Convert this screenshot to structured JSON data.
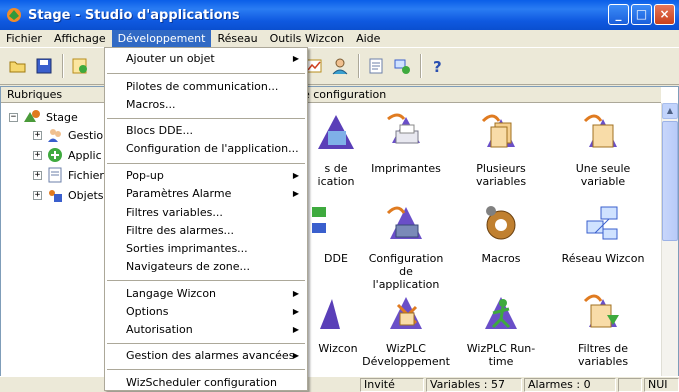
{
  "window": {
    "title": "Stage - Studio d'applications"
  },
  "menubar": [
    "Fichier",
    "Affichage",
    "Développement",
    "Réseau",
    "Outils Wizcon",
    "Aide"
  ],
  "dropdown": {
    "items": [
      {
        "label": "Ajouter un objet",
        "submenu": true
      },
      {
        "label": "Pilotes de communication...",
        "submenu": false
      },
      {
        "label": "Macros...",
        "submenu": false
      },
      {
        "label": "Blocs DDE...",
        "submenu": false
      },
      {
        "label": "Configuration de l'application...",
        "submenu": false
      },
      {
        "label": "Pop-up",
        "submenu": true
      },
      {
        "label": "Paramètres Alarme",
        "submenu": true
      },
      {
        "label": "Filtres variables...",
        "submenu": false
      },
      {
        "label": "Filtre des alarmes...",
        "submenu": false
      },
      {
        "label": "Sorties imprimantes...",
        "submenu": false
      },
      {
        "label": "Navigateurs de zone...",
        "submenu": false
      },
      {
        "label": "Langage Wizcon",
        "submenu": true
      },
      {
        "label": "Options",
        "submenu": true
      },
      {
        "label": "Autorisation",
        "submenu": true
      },
      {
        "label": "Gestion des alarmes avancées",
        "submenu": true
      },
      {
        "label": "WizScheduler configuration",
        "submenu": false
      }
    ]
  },
  "left_pane": {
    "header": "Rubriques",
    "root": "Stage",
    "children": [
      "Gestio",
      "Applic",
      "Fichier",
      "Objets"
    ]
  },
  "right_pane": {
    "header": "e configuration",
    "icons": [
      {
        "label": "s de\nication"
      },
      {
        "label": "Imprimantes"
      },
      {
        "label": "Plusieurs variables"
      },
      {
        "label": "Une seule variable"
      },
      {
        "label": "DDE"
      },
      {
        "label": "Configuration de\nl'application"
      },
      {
        "label": "Macros"
      },
      {
        "label": "Réseau Wizcon"
      },
      {
        "label": "Wizcon"
      },
      {
        "label": "WizPLC\nDéveloppement"
      },
      {
        "label": "WizPLC Run-time"
      },
      {
        "label": "Filtres de variables"
      }
    ]
  },
  "statusbar": {
    "user": "Invité",
    "variables": "Variables : 57",
    "alarmes": "Alarmes : 0",
    "mode": "NUI"
  },
  "colors": {
    "accent": "#316ac5",
    "titlebar": "#0a5ee8"
  }
}
